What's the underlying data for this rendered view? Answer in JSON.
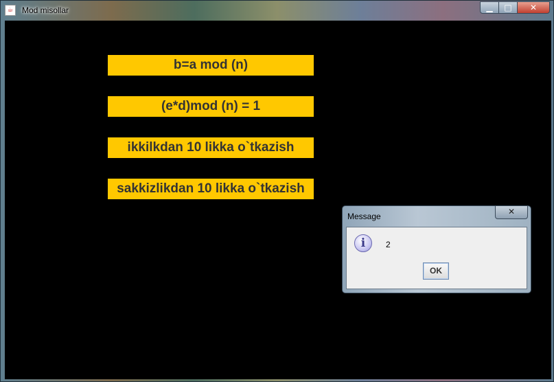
{
  "window": {
    "title": "Mod misollar",
    "app_icon": "java-cup-icon",
    "controls": {
      "minimize": "minimize-icon",
      "maximize": "maximize-icon",
      "close": "close-icon"
    }
  },
  "buttons": [
    {
      "label": "b=a mod (n)"
    },
    {
      "label": "(e*d)mod (n) = 1"
    },
    {
      "label": "ikkilkdan 10 likka o`tkazish"
    },
    {
      "label": "sakkizlikdan 10 likka o`tkazish"
    }
  ],
  "colors": {
    "button_bg": "#ffc800",
    "client_bg": "#000000"
  },
  "dialog": {
    "title": "Message",
    "icon": "info-icon",
    "message": "2",
    "ok_label": "OK"
  }
}
